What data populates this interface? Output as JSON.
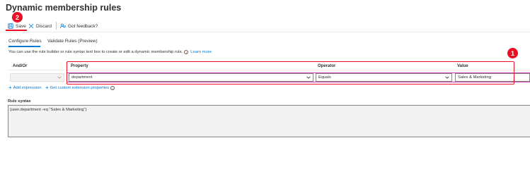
{
  "header": {
    "title": "Dynamic membership rules",
    "more_glyph": "···"
  },
  "annotations": {
    "step_save": "2",
    "step_property": "1",
    "highlight_color": "#e81123"
  },
  "toolbar": {
    "save_label": "Save",
    "discard_label": "Discard",
    "feedback_label": "Got feedback?"
  },
  "tabs": [
    {
      "label": "Configure Rules",
      "active": true
    },
    {
      "label": "Validate Rules (Preview)",
      "active": false
    }
  ],
  "description": {
    "text": "You can use the rule builder or rule syntax text box to create or edit a dynamic membership rule.",
    "link": "Learn more"
  },
  "rule_table": {
    "columns": {
      "and_or": "And/Or",
      "property": "Property",
      "operator": "Operator",
      "value": "Value"
    },
    "row": {
      "and_or": "",
      "property": "department",
      "operator": "Equals",
      "value": "Sales & Marketing"
    }
  },
  "actions": {
    "add_expression": "Add expression",
    "get_custom_extension": "Get custom extension properties"
  },
  "rule_syntax": {
    "label": "Rule syntax",
    "value": "(user.department -eq \"Sales & Marketing\")"
  },
  "colors": {
    "accent": "#0078d4",
    "annotation_red": "#e81123",
    "row_focus": "#c239b3"
  },
  "icons": {
    "save": "save-icon",
    "discard": "close-icon",
    "feedback": "feedback-icon",
    "info": "info-icon",
    "chevron": "chevron-down-icon"
  }
}
